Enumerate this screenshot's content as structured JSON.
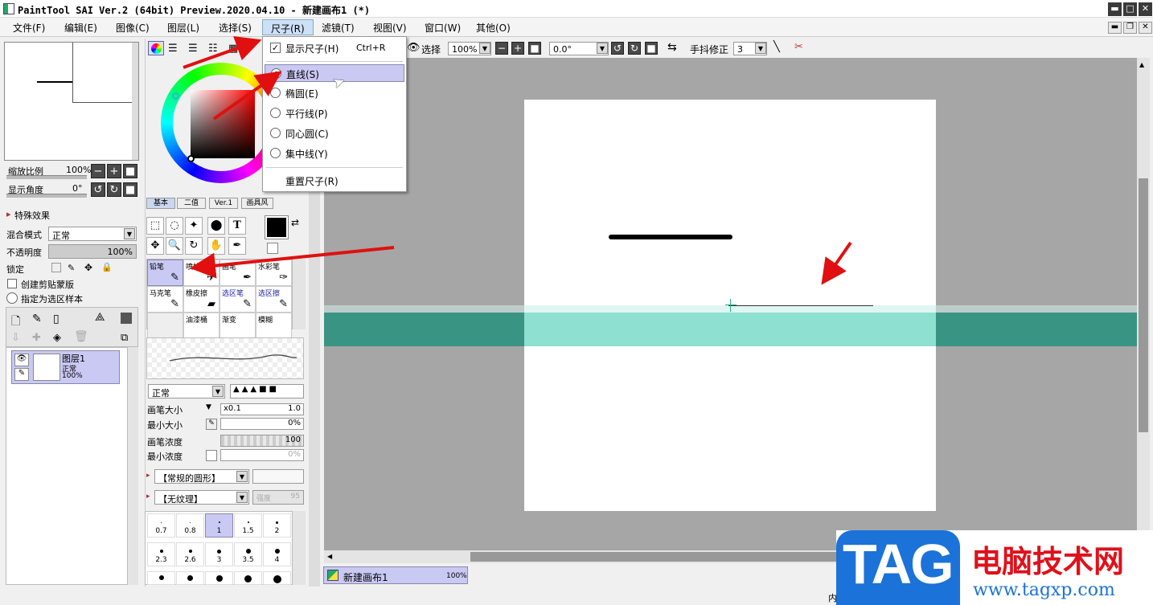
{
  "window": {
    "title": "PaintTool SAI Ver.2 (64bit) Preview.2020.04.10 - 新建画布1 (*)",
    "minimize": "▬",
    "maximize": "□",
    "close": "✕"
  },
  "menubar": {
    "items": [
      "文件(F)",
      "编辑(E)",
      "图像(C)",
      "图层(L)",
      "选择(S)",
      "尺子(R)",
      "滤镜(T)",
      "视图(V)",
      "窗口(W)",
      "其他(O)"
    ],
    "active_index": 5
  },
  "ruler_menu": {
    "show_ruler": {
      "label": "显示尺子(H)",
      "shortcut": "Ctrl+R",
      "checked": true
    },
    "options": [
      {
        "label": "直线(S)",
        "selected": true
      },
      {
        "label": "椭圆(E)",
        "selected": false
      },
      {
        "label": "平行线(P)",
        "selected": false
      },
      {
        "label": "同心圆(C)",
        "selected": false
      },
      {
        "label": "集中线(Y)",
        "selected": false
      }
    ],
    "reset": "重置尺子(R)"
  },
  "navigator": {
    "zoom_label": "缩放比例",
    "zoom_value": "100%",
    "angle_label": "显示角度",
    "angle_value": "0°"
  },
  "layer_panel": {
    "effects_label": "特殊效果",
    "blend_label": "混合模式",
    "blend_value": "正常",
    "opacity_label": "不透明度",
    "opacity_value": "100%",
    "lock_label": "锁定",
    "clip_label": "创建剪贴蒙版",
    "sample_label": "指定为选区样本",
    "layer": {
      "name": "图层1",
      "mode": "正常",
      "opacity": "100%"
    }
  },
  "tool_tabs": [
    "基本",
    "二值",
    "Ver.1",
    "画具风"
  ],
  "brushes": [
    {
      "label": "铅笔"
    },
    {
      "label": "喷枪"
    },
    {
      "label": "画笔"
    },
    {
      "label": "水彩笔"
    },
    {
      "label": "马克笔"
    },
    {
      "label": "橡皮擦"
    },
    {
      "label": "选区笔"
    },
    {
      "label": "选区擦"
    },
    {
      "label": ""
    },
    {
      "label": "油漆桶"
    },
    {
      "label": "渐变"
    },
    {
      "label": "模糊"
    }
  ],
  "brush_settings": {
    "mode_value": "正常",
    "size_label": "画笔大小",
    "size_mult": "x0.1",
    "size_value": "1.0",
    "min_size_label": "最小大小",
    "min_size_value": "0%",
    "density_label": "画笔浓度",
    "density_value": "100",
    "min_density_label": "最小浓度",
    "min_density_value": "0%",
    "shape_value": "【常规的圆形】",
    "texture_value": "【无纹理】",
    "texture_strength_label": "强度",
    "texture_strength_value": "95"
  },
  "brush_sizes": [
    "0.7",
    "0.8",
    "1",
    "1.5",
    "2",
    "2.3",
    "2.6",
    "3",
    "3.5",
    "4"
  ],
  "canvas_toolbar": {
    "select_label": "选择",
    "zoom_value": "100%",
    "angle_value": "0.0°",
    "stabilizer_label": "手抖修正",
    "stabilizer_value": "3"
  },
  "canvas_tab": {
    "name": "新建画布1",
    "zoom": "100%"
  },
  "status": {
    "text": "内"
  },
  "watermark": {
    "logo": "TAG",
    "site_name": "电脑技术网",
    "url": "www.tagxp.com"
  },
  "colors": {
    "ruler_band": "#3a9484",
    "ruler_band_light": "#8ee0d0",
    "highlight": "#c9c9f4",
    "arrow": "#e01010"
  }
}
